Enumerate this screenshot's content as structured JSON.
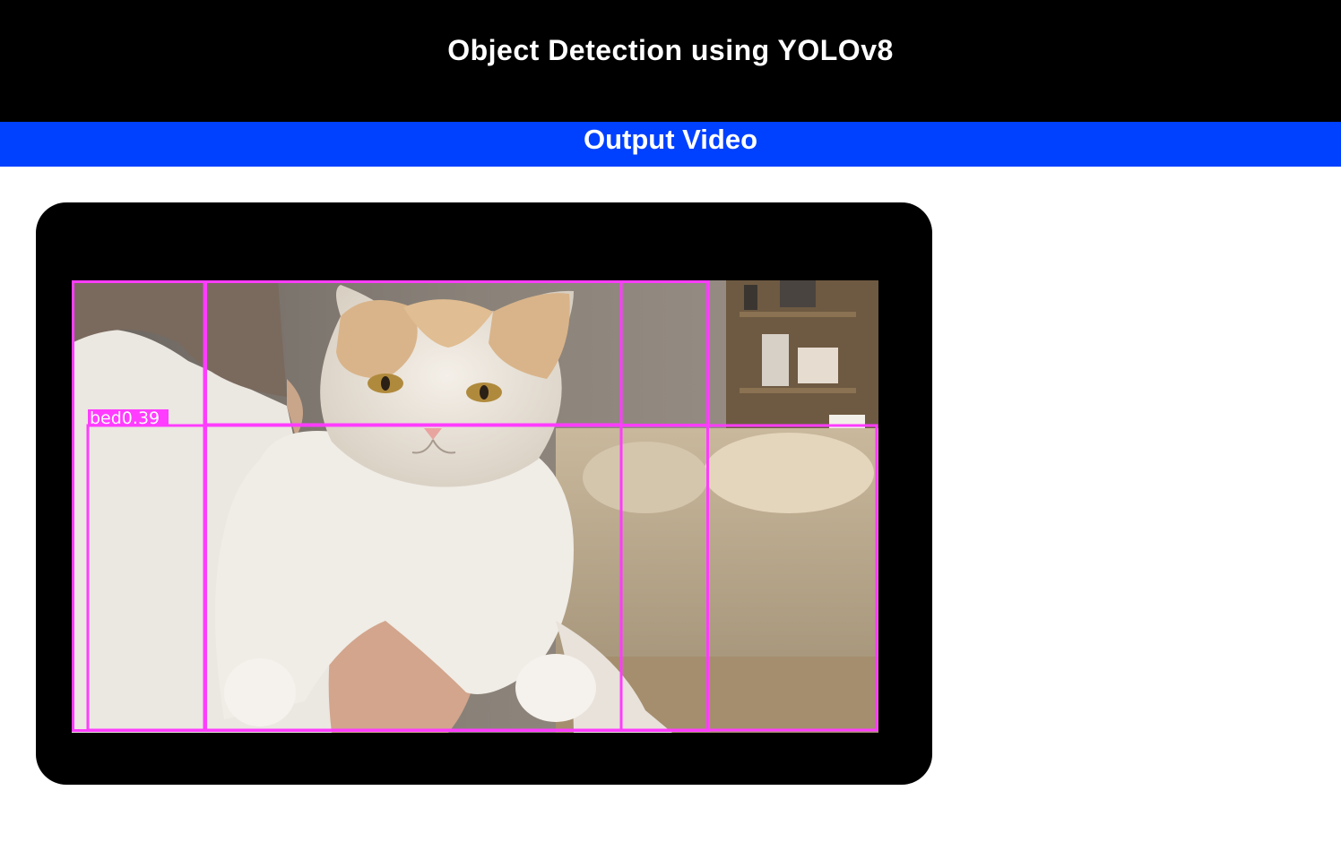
{
  "header": {
    "title": "Object Detection using YOLOv8"
  },
  "section": {
    "title": "Output Video"
  },
  "video": {
    "detections": [
      {
        "label": "bed0.39",
        "class": "bed",
        "confidence": 0.39
      }
    ]
  },
  "colors": {
    "header_bg": "#000000",
    "section_bar_bg": "#0040ff",
    "box_stroke": "#ff3cff",
    "player_bg": "#000000"
  }
}
